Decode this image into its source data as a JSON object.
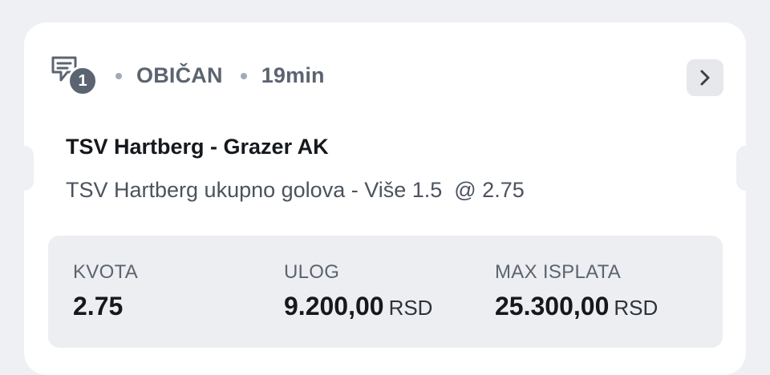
{
  "ticket": {
    "count": "1",
    "type": "OBIČAN",
    "time": "19min"
  },
  "event": {
    "match": "TSV Hartberg - Grazer AK",
    "selection": "TSV Hartberg ukupno golova - Više 1.5  @ 2.75"
  },
  "summary": {
    "odds_label": "KVOTA",
    "odds_value": "2.75",
    "stake_label": "ULOG",
    "stake_value": "9.200,00",
    "stake_currency": "RSD",
    "payout_label": "MAX ISPLATA",
    "payout_value": "25.300,00",
    "payout_currency": "RSD"
  },
  "icons": {
    "ticket": "ticket-icon",
    "open_details": "chevron-right-icon"
  },
  "colors": {
    "background": "#eef0f3",
    "card": "#ffffff",
    "muted_text": "#5b6470",
    "summary_bg": "#eceef1"
  }
}
